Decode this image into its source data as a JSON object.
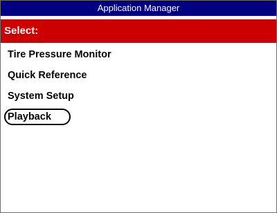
{
  "window": {
    "title": "Application Manager"
  },
  "header": {
    "label": "Select:",
    "color": "#cc0000"
  },
  "title_bar_color": "#000080",
  "menu": {
    "items": [
      {
        "label": "Tire Pressure Monitor",
        "selected": false
      },
      {
        "label": "Quick Reference",
        "selected": false
      },
      {
        "label": "System Setup",
        "selected": false
      },
      {
        "label": "Playback",
        "selected": true
      }
    ]
  }
}
